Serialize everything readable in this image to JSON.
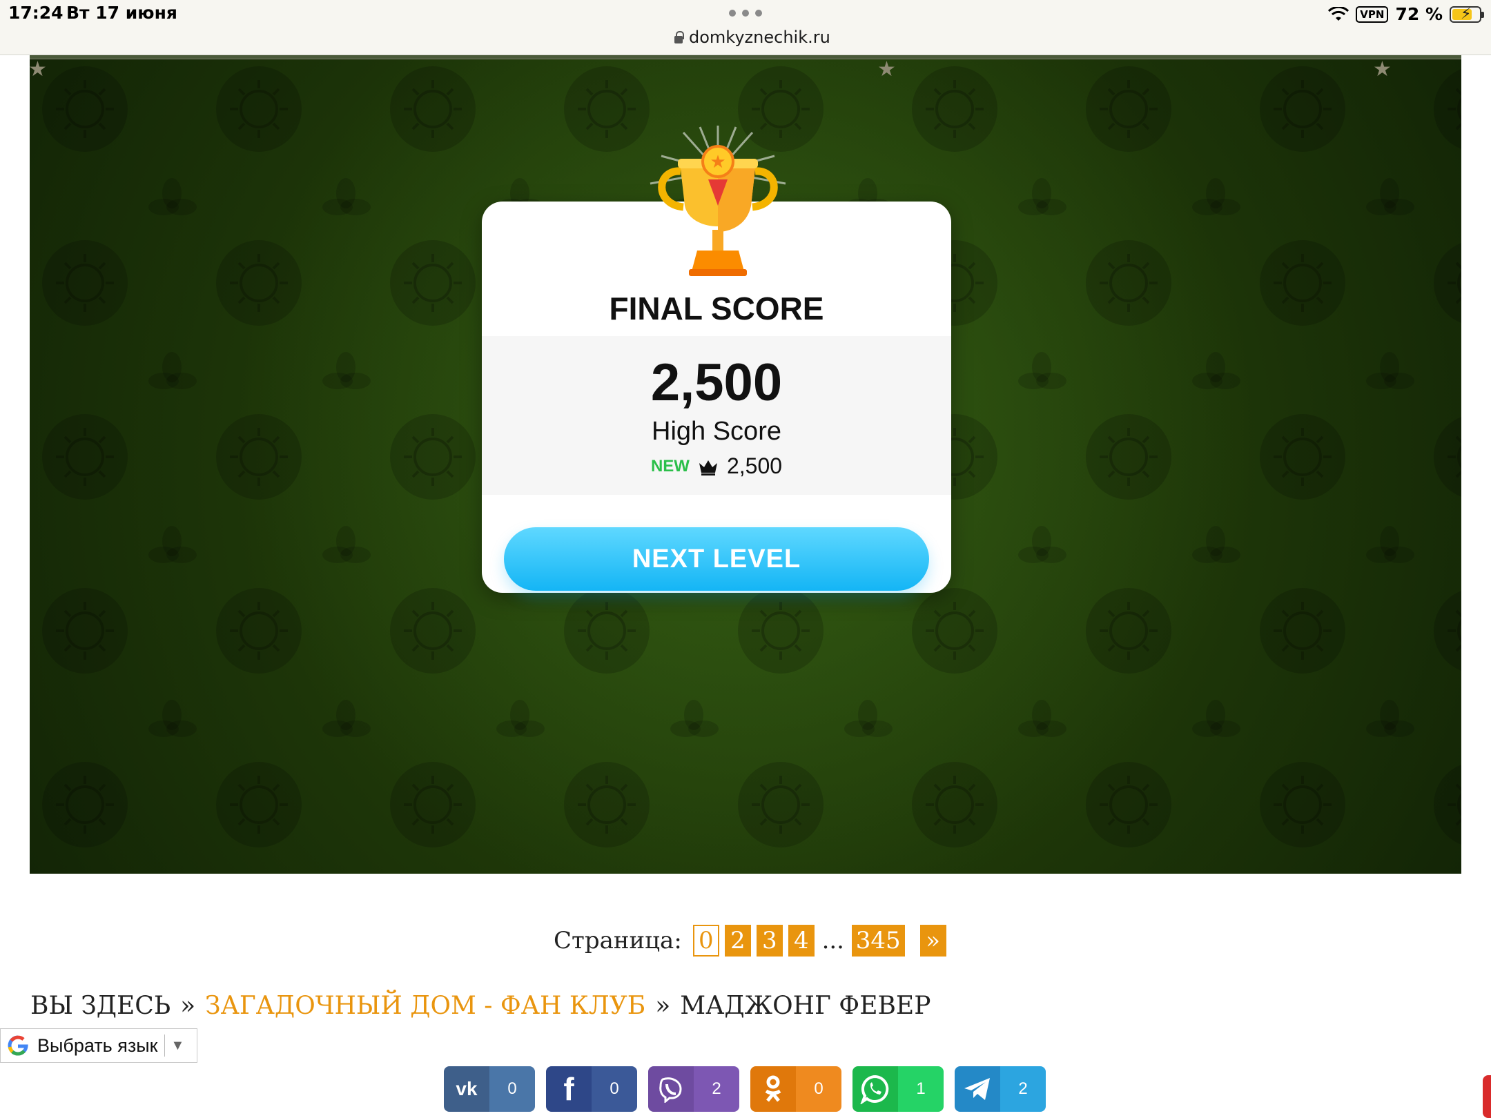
{
  "status_bar": {
    "time": "17:24",
    "date": "Вт 17 июня",
    "url": "domkyznechik.ru",
    "vpn": "VPN",
    "battery": "72 %"
  },
  "dialog": {
    "title": "FINAL SCORE",
    "score": "2,500",
    "high_score_label": "High Score",
    "new_badge": "NEW",
    "high_score_value": "2,500",
    "next_button": "NEXT LEVEL",
    "trophy_icon": "trophy-icon",
    "crown_icon": "crown-icon"
  },
  "pagination": {
    "label": "Страница:",
    "pages": [
      "0",
      "2",
      "3",
      "4"
    ],
    "ellipsis": "...",
    "last": "345",
    "next": "»"
  },
  "breadcrumb": {
    "prefix": "ВЫ ЗДЕСЬ",
    "sep": "»",
    "link": "ЗАГАДОЧНЫЙ ДОМ - ФАН КЛУБ",
    "current": "МАДЖОНГ ФЕВЕР"
  },
  "translate": {
    "label": "Выбрать язык",
    "caret": "▼"
  },
  "share": {
    "vk": {
      "icon": "vk-icon",
      "count": "0"
    },
    "facebook": {
      "icon": "facebook-icon",
      "count": "0"
    },
    "viber": {
      "icon": "viber-icon",
      "count": "2"
    },
    "odnoklassniki": {
      "icon": "odnoklassniki-icon",
      "count": "0"
    },
    "whatsapp": {
      "icon": "whatsapp-icon",
      "count": "1"
    },
    "telegram": {
      "icon": "telegram-icon",
      "count": "2"
    }
  },
  "colors": {
    "accent_orange": "#e9950e",
    "button_blue": "#14b5f5",
    "game_green": "#1d3508",
    "new_green": "#2bbf4a"
  }
}
